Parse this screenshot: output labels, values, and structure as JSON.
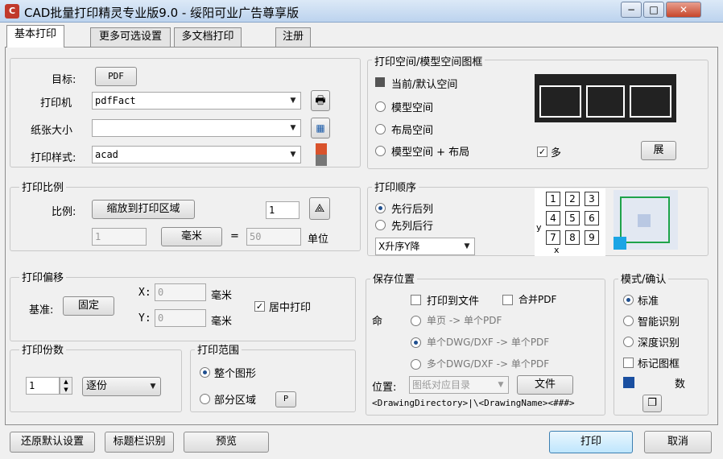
{
  "window": {
    "title": "CAD批量打印精灵专业版9.0 - 绥阳可业广告尊享版",
    "app_icon_glyph": "C",
    "minimize": "−",
    "maximize": "□",
    "close": "✕"
  },
  "tabs": [
    "基本打印",
    "更多可选设置",
    "多文档打印",
    "注册"
  ],
  "target": {
    "label": "目标:",
    "value": "PDF"
  },
  "printer": {
    "label": "打印机",
    "value": "pdfFact"
  },
  "paper": {
    "label": "纸张大小",
    "value": ""
  },
  "style": {
    "label": "打印样式:",
    "value": "acad"
  },
  "space_group": {
    "title": "打印空间/模型空间图框",
    "options": [
      "当前/默认空间",
      "模型空间",
      "布局空间",
      "模型空间 + 布局"
    ],
    "multi_checkbox": "多",
    "expand_button": "展"
  },
  "scale_group": {
    "title": "打印比例",
    "label": "比例:",
    "fit_button": "缩放到打印区域",
    "ratio_value": "1",
    "left_value": "1",
    "unit_button": "毫米",
    "equals": "=",
    "right_value": "50",
    "unit_label": "单位"
  },
  "order_group": {
    "title": "打印顺序",
    "options": [
      "先行后列",
      "先列后行"
    ],
    "sort_value": "X升序Y降",
    "axis_y": "y",
    "axis_x": "x",
    "grid_numbers": [
      "1",
      "2",
      "3",
      "4",
      "5",
      "6",
      "7",
      "8",
      "9"
    ]
  },
  "offset_group": {
    "title": "打印偏移",
    "base_label": "基准:",
    "base_value": "固定",
    "x_label": "X:",
    "x_value": "0",
    "y_label": "Y:",
    "y_value": "0",
    "unit": "毫米",
    "center_checkbox": "居中打印"
  },
  "copies_group": {
    "title": "打印份数",
    "value": "1",
    "mode": "逐份"
  },
  "range_group": {
    "title": "打印范围",
    "options": [
      "整个图形",
      "部分区域"
    ],
    "pick_button": "P"
  },
  "save_group": {
    "title": "保存位置",
    "print_to_file": "打印到文件",
    "merge_pdf": "合并PDF",
    "opt1": "单页 -> 单个PDF",
    "opt2": "单个DWG/DXF -> 单个PDF",
    "opt3": "多个DWG/DXF -> 单个PDF",
    "position_label": "位置:",
    "position_value": "图纸对应目录",
    "file_button": "文件",
    "path": "<DrawingDirectory>|\\<DrawingName><###>",
    "side_label": "命"
  },
  "mode_group": {
    "title": "模式/确认",
    "options": [
      "标准",
      "智能识别",
      "深度识别"
    ],
    "mark_frame": "标记图框",
    "count": "数"
  },
  "bottom": {
    "restore": "还原默认设置",
    "title_detect": "标题栏识别",
    "preview": "预览",
    "print": "打印",
    "cancel": "取消"
  }
}
